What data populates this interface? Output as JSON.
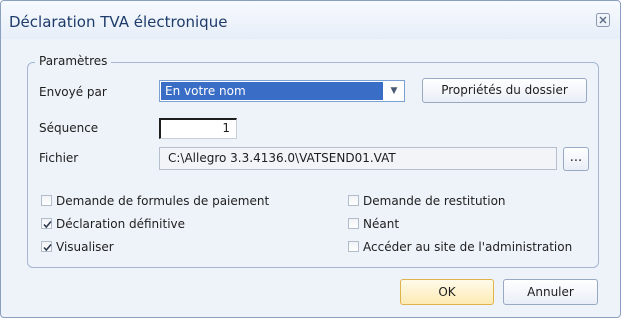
{
  "window": {
    "title": "Déclaration TVA électronique",
    "close_icon": "close-icon"
  },
  "params_group": {
    "legend": "Paramètres"
  },
  "sent_by": {
    "label": "Envoyé par",
    "value": "En votre nom"
  },
  "folder_props_button": "Propriétés du dossier",
  "sequence": {
    "label": "Séquence",
    "value": "1"
  },
  "file": {
    "label": "Fichier",
    "value": "C:\\Allegro 3.3.4136.0\\VATSEND01.VAT",
    "browse_label": "..."
  },
  "options": [
    {
      "label": "Demande de formules de paiement",
      "checked": false
    },
    {
      "label": "Demande de restitution",
      "checked": false
    },
    {
      "label": "Déclaration définitive",
      "checked": true
    },
    {
      "label": "Néant",
      "checked": false
    },
    {
      "label": "Visualiser",
      "checked": true
    },
    {
      "label": "Accéder au site de l'administration",
      "checked": false
    }
  ],
  "buttons": {
    "ok": "OK",
    "cancel": "Annuler"
  },
  "colors": {
    "accent": "#3a6dc5",
    "window_bg": "#eef3fa",
    "ok_border": "#e0b24a"
  }
}
